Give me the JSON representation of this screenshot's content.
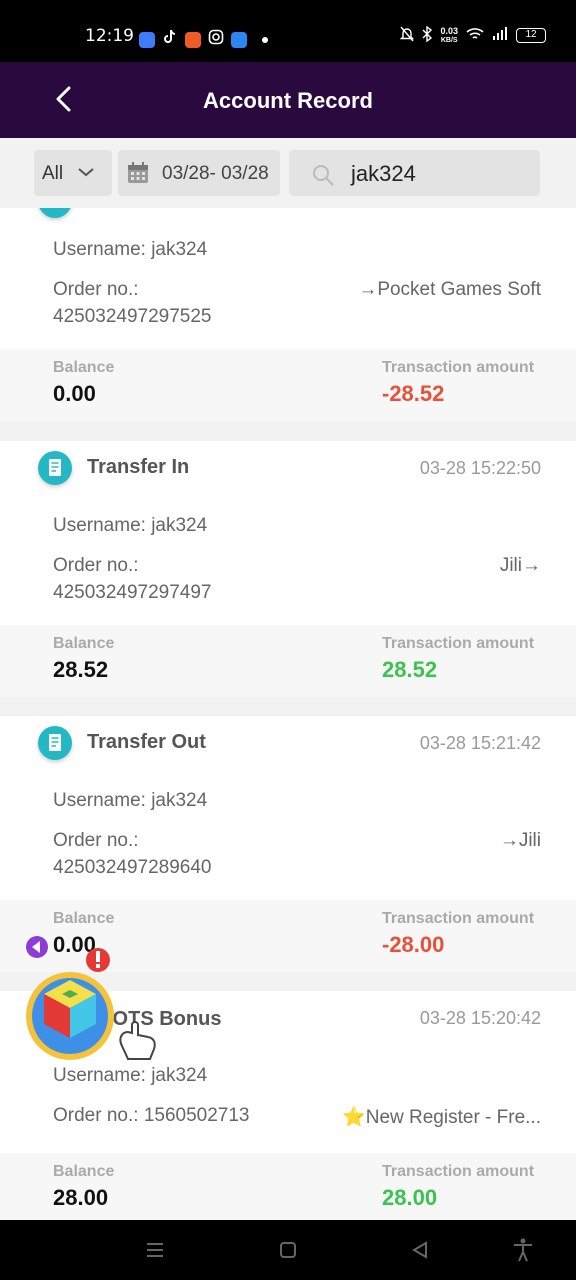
{
  "status_bar": {
    "time": "12:19",
    "net_speed": "0.03",
    "net_unit": "KB/S",
    "battery": "12"
  },
  "header": {
    "title": "Account Record",
    "back_icon": "chevron-left-icon"
  },
  "filter": {
    "type_selected": "All",
    "date_range": "03/28- 03/28",
    "search_value": "jak324"
  },
  "records": [
    {
      "type": "",
      "time": "",
      "username_label": "Username: jak324",
      "order_label": "Order no.:",
      "order_no": "425032497297525",
      "route": "→Pocket Games Soft",
      "balance_label": "Balance",
      "balance": "0.00",
      "amount_label": "Transaction amount",
      "amount": "-28.52",
      "amount_sign": "negative"
    },
    {
      "type": "Transfer In",
      "time": "03-28 15:22:50",
      "username_label": "Username: jak324",
      "order_label": "Order no.:",
      "order_no": "425032497297497",
      "route": "Jili→",
      "balance_label": "Balance",
      "balance": "28.52",
      "amount_label": "Transaction amount",
      "amount": "28.52",
      "amount_sign": "positive"
    },
    {
      "type": "Transfer Out",
      "time": "03-28 15:21:42",
      "username_label": "Username: jak324",
      "order_label": "Order no.:",
      "order_no": "425032497289640",
      "route": "→Jili",
      "balance_label": "Balance",
      "balance": "0.00",
      "amount_label": "Transaction amount",
      "amount": "-28.00",
      "amount_sign": "negative"
    },
    {
      "type": "SLOTS Bonus",
      "time": "03-28 15:20:42",
      "username_label": "Username: jak324",
      "order_label": "Order no.: 1560502713",
      "order_no": "",
      "route": "⭐New Register - Fre...",
      "balance_label": "Balance",
      "balance": "28.00",
      "amount_label": "Transaction amount",
      "amount": "28.00",
      "amount_sign": "positive"
    }
  ],
  "colors": {
    "header_bg": "#2a0a3e",
    "negative": "#e8503a",
    "positive": "#3cc24f",
    "record_icon": "#23b8c4"
  }
}
